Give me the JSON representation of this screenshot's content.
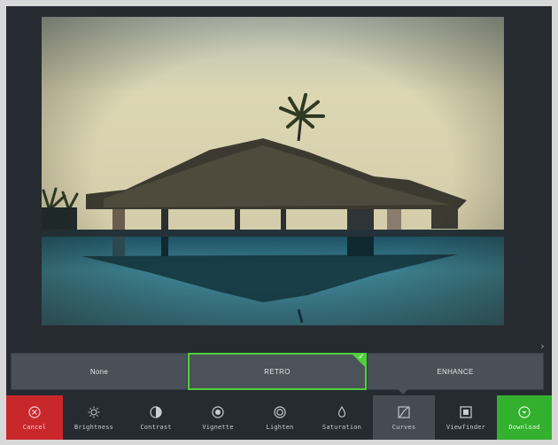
{
  "filters": [
    {
      "label": "None",
      "active": false
    },
    {
      "label": "RETRO",
      "active": true
    },
    {
      "label": "ENHANCE",
      "active": false
    }
  ],
  "toolbar": {
    "cancel": "Cancel",
    "brightness": "Brightness",
    "contrast": "Contrast",
    "vignette": "Vignette",
    "lighten": "Lighten",
    "saturation": "Saturation",
    "curves": "Curves",
    "viewfinder": "Viewfinder",
    "download": "Download"
  },
  "icons": {
    "cancel": "close-circle-icon",
    "brightness": "sun-icon",
    "contrast": "half-circle-icon",
    "vignette": "target-icon",
    "lighten": "ring-icon",
    "saturation": "drop-icon",
    "curves": "curve-icon",
    "viewfinder": "square-icon",
    "download": "arrow-down-circle-icon"
  },
  "colors": {
    "accent": "#4fcf3a",
    "cancel": "#c8282c",
    "download": "#33b02e",
    "panel": "#262b32"
  }
}
